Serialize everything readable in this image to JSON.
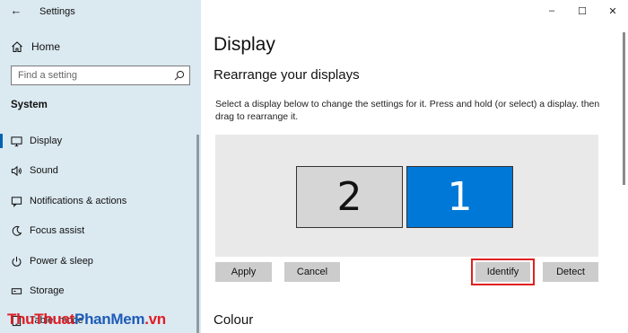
{
  "window": {
    "title": "Settings",
    "back_glyph": "←",
    "controls": {
      "minimize": "–",
      "maximize": "☐",
      "close": "✕"
    }
  },
  "sidebar": {
    "home_label": "Home",
    "search_placeholder": "Find a setting",
    "section_label": "System",
    "items": [
      {
        "label": "Display",
        "icon": "monitor-icon",
        "active": true
      },
      {
        "label": "Sound",
        "icon": "speaker-icon",
        "active": false
      },
      {
        "label": "Notifications & actions",
        "icon": "notifications-icon",
        "active": false
      },
      {
        "label": "Focus assist",
        "icon": "moon-icon",
        "active": false
      },
      {
        "label": "Power & sleep",
        "icon": "power-icon",
        "active": false
      },
      {
        "label": "Storage",
        "icon": "storage-icon",
        "active": false
      },
      {
        "label": "Tablet mode",
        "icon": "tablet-icon",
        "active": false
      }
    ]
  },
  "watermark": {
    "part1": "ThuThuat",
    "part2": "PhanMem",
    "part3": ".vn"
  },
  "main": {
    "title": "Display",
    "subtitle": "Rearrange your displays",
    "description": "Select a display below to change the settings for it. Press and hold (or select) a display. then drag to rearrange it.",
    "monitors": [
      {
        "number": "2",
        "selected": false
      },
      {
        "number": "1",
        "selected": true
      }
    ],
    "buttons": {
      "apply": "Apply",
      "cancel": "Cancel",
      "identify": "Identify",
      "detect": "Detect"
    },
    "next_section": "Colour"
  },
  "colors": {
    "sidebar_bg": "#dbe9f1",
    "accent": "#0078d7",
    "highlight": "#e02020"
  }
}
